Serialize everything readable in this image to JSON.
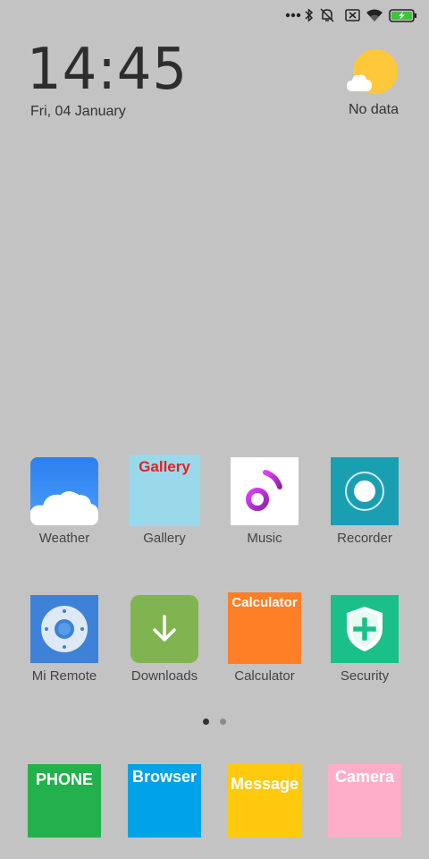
{
  "status": {
    "icons": [
      "more-dots-icon",
      "bluetooth-icon",
      "mute-bell-icon",
      "sim-off-icon",
      "wifi-icon",
      "battery-charging-icon"
    ],
    "battery_color": "#3cc43c"
  },
  "clock": {
    "time": "14:45",
    "date": "Fri, 04 January"
  },
  "weather": {
    "status": "No data"
  },
  "apps_row1": [
    {
      "label": "Weather",
      "tile_text": ""
    },
    {
      "label": "Gallery",
      "tile_text": "Gallery"
    },
    {
      "label": "Music",
      "tile_text": ""
    },
    {
      "label": "Recorder",
      "tile_text": ""
    }
  ],
  "apps_row2": [
    {
      "label": "Mi Remote",
      "tile_text": ""
    },
    {
      "label": "Downloads",
      "tile_text": ""
    },
    {
      "label": "Calculator",
      "tile_text": "Calculator"
    },
    {
      "label": "Security",
      "tile_text": ""
    }
  ],
  "dock": [
    {
      "tile_text": "PHONE",
      "color": "#22b14c"
    },
    {
      "tile_text": "Browser",
      "color": "#00a2e8"
    },
    {
      "tile_text": "Message",
      "color": "#ffc90e"
    },
    {
      "tile_text": "Camera",
      "color": "#ffaec9"
    }
  ],
  "page_indicator": {
    "current": 1,
    "total": 2
  }
}
